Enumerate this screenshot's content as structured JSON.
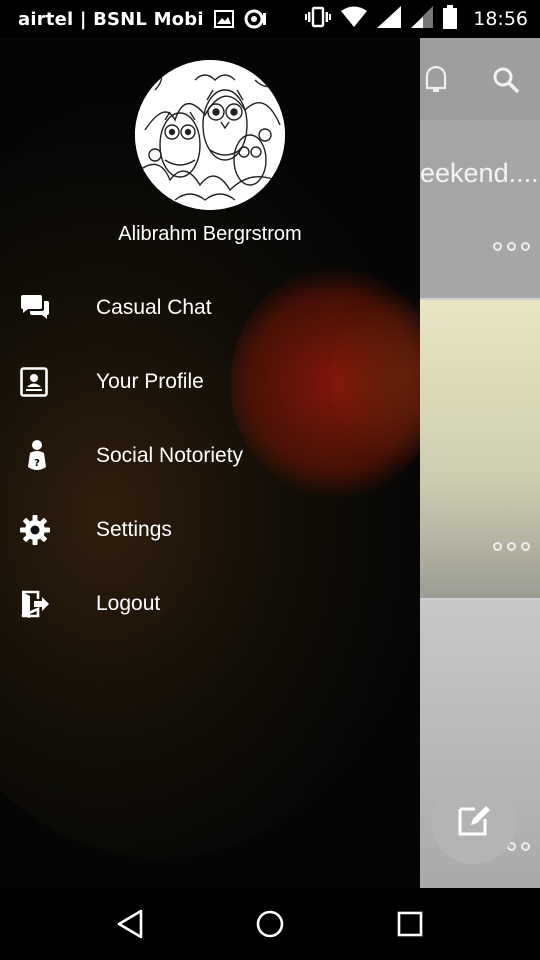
{
  "status_bar": {
    "carrier": "airtel | BSNL Mobi",
    "time": "18:56",
    "icons": [
      "image-notification-icon",
      "sync-notification-icon",
      "vibrate-icon",
      "wifi-icon",
      "signal-icon",
      "signal-weak-icon",
      "battery-icon"
    ]
  },
  "drawer": {
    "user_name": "Alibrahm Bergrstrom",
    "avatar": "owls-avatar-icon",
    "menu": [
      {
        "label": "Casual Chat",
        "icon": "chat-bubbles-icon"
      },
      {
        "label": "Your Profile",
        "icon": "profile-card-icon"
      },
      {
        "label": "Social Notoriety",
        "icon": "notoriety-icon"
      },
      {
        "label": "Settings",
        "icon": "gear-icon"
      },
      {
        "label": "Logout",
        "icon": "logout-icon"
      }
    ]
  },
  "background_app": {
    "card1_text": "eekend...."
  },
  "nav_bar": {
    "buttons": [
      "back-icon",
      "home-icon",
      "recents-icon"
    ]
  },
  "colors": {
    "drawer_bg": "#050505",
    "glow": "#961908",
    "text": "#ffffff"
  }
}
